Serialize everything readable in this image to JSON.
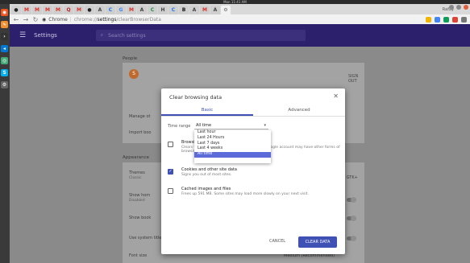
{
  "system": {
    "clock": "Mon 11:41 AM"
  },
  "browser": {
    "tabs": [
      {
        "label": "",
        "icon": "github-icon",
        "color": "#222"
      },
      {
        "label": "M",
        "color": "#d93025"
      },
      {
        "label": "M",
        "color": "#d93025"
      },
      {
        "label": "M",
        "color": "#d93025"
      },
      {
        "label": "M",
        "color": "#d93025"
      },
      {
        "label": "Q",
        "color": "#b22"
      },
      {
        "label": "M",
        "color": "#d93025"
      },
      {
        "label": "",
        "icon": "github-icon",
        "color": "#222"
      },
      {
        "label": "A",
        "color": "#444"
      },
      {
        "label": "C",
        "color": "#1a73e8"
      },
      {
        "label": "G",
        "color": "#4285f4"
      },
      {
        "label": "M",
        "color": "#d93025"
      },
      {
        "label": "A",
        "color": "#444"
      },
      {
        "label": "C",
        "color": "#1e8e3e"
      },
      {
        "label": "H",
        "color": "#444"
      },
      {
        "label": "C",
        "color": "#1a73e8"
      },
      {
        "label": "B",
        "color": "#111"
      },
      {
        "label": "A",
        "color": "#444"
      },
      {
        "label": "M",
        "color": "#d93025"
      },
      {
        "label": "A",
        "color": "#444"
      },
      {
        "label": "⚙",
        "color": "#666",
        "active": true
      }
    ],
    "profile": "Rafay",
    "url": {
      "chip": "Chrome",
      "scheme": "chrome://",
      "host": "settings",
      "path": "/clearBrowserData"
    }
  },
  "settings": {
    "title": "Settings",
    "search_placeholder": "Search settings",
    "people_label": "People",
    "avatar_letter": "S",
    "sign_out": "SIGN OUT",
    "manage_label": "Manage ot",
    "import_label": "Import boo",
    "appearance_label": "Appearance",
    "themes_label": "Themes",
    "themes_sub": "Classic",
    "themes_action": "USE GTK+",
    "show_home_label": "Show hom",
    "show_home_sub": "Disabled",
    "show_bookmarks_label": "Show book",
    "system_title_bar": "Use system title bar and borders",
    "font_size_label": "Font size",
    "font_size_value": "Medium (Recommended)"
  },
  "dialog": {
    "title": "Clear browsing data",
    "tabs": [
      "Basic",
      "Advanced"
    ],
    "time_range_label": "Time range",
    "time_range_value": "All time",
    "time_range_options": [
      "Last hour",
      "Last 24 Hours",
      "Last 7 days",
      "Last 4 weeks",
      "All time"
    ],
    "options": [
      {
        "title": "Browsing history",
        "sub": "Clears history from all signed-in devices. Your Google account may have other forms of browsing history at",
        "link": "myactivity.google.com.",
        "checked": false
      },
      {
        "title": "Cookies and other site data",
        "sub": "Signs you out of most sites.",
        "checked": true
      },
      {
        "title": "Cached images and files",
        "sub": "Frees up 591 MB. Some sites may load more slowly on your next visit.",
        "checked": false
      }
    ],
    "cancel_label": "CANCEL",
    "clear_label": "CLEAR DATA"
  },
  "colors": {
    "accent": "#3f51b5",
    "header": "#2c1f6b"
  }
}
